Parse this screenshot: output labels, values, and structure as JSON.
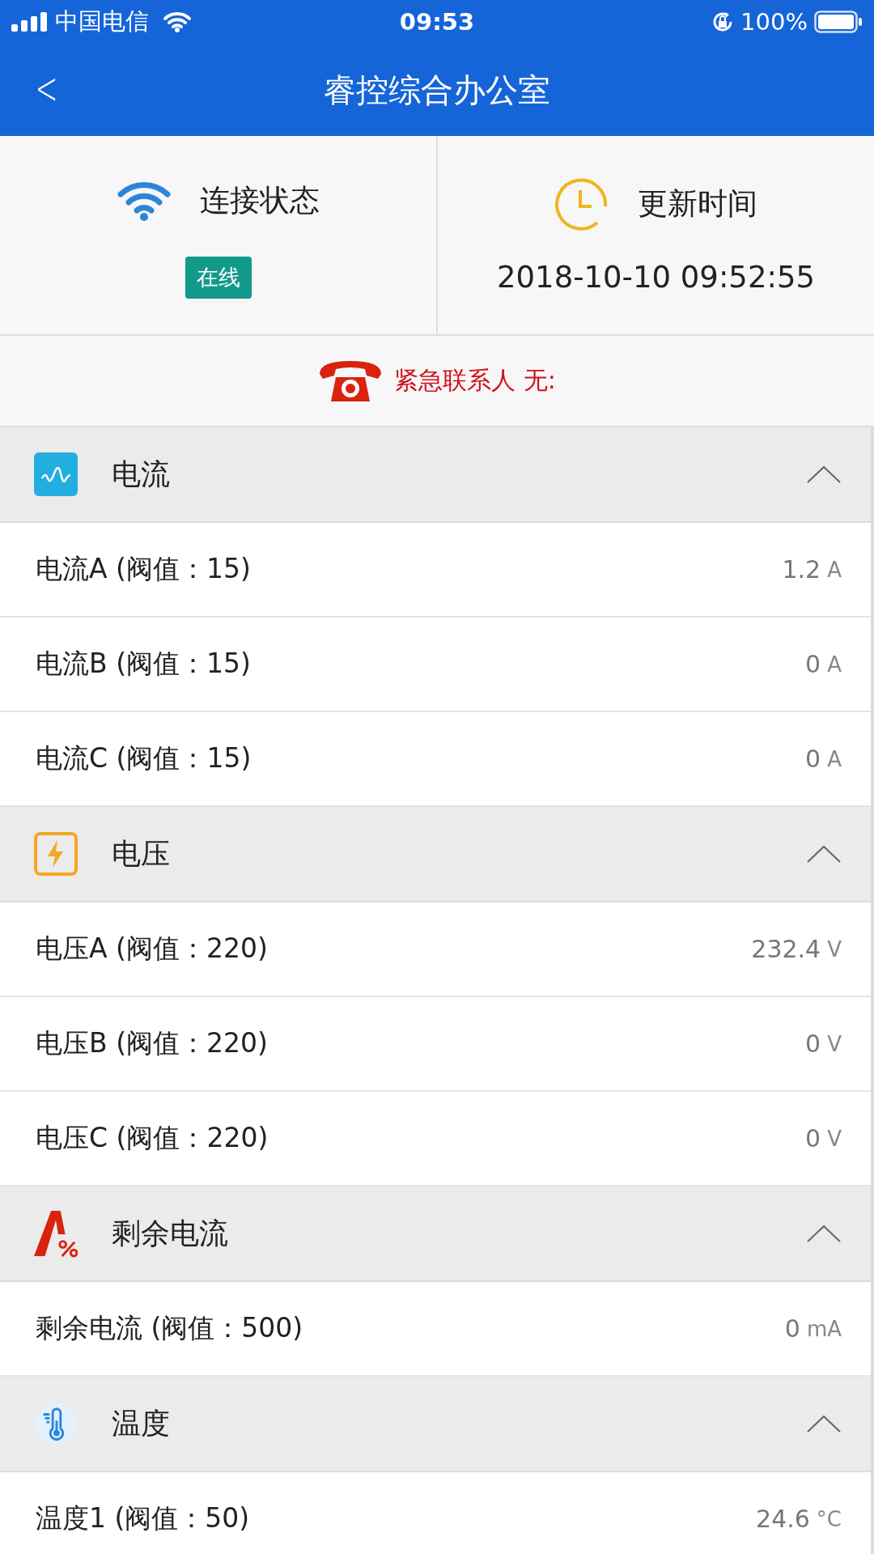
{
  "status_bar": {
    "carrier": "中国电信",
    "time": "09:53",
    "battery": "100%"
  },
  "nav": {
    "back": "<",
    "title": "睿控综合办公室"
  },
  "status_cards": [
    {
      "kind": "wifi",
      "label": "连接状态",
      "badge": "在线"
    },
    {
      "kind": "clock",
      "label": "更新时间",
      "value": "2018-10-10 09:52:55"
    }
  ],
  "emergency": {
    "text": "紧急联系人 无:"
  },
  "sections": [
    {
      "kind": "wave",
      "title": "电流",
      "expanded": true,
      "rows": [
        {
          "label": "电流A (阀值：15)",
          "value": "1.2",
          "unit": "A"
        },
        {
          "label": "电流B (阀值：15)",
          "value": "0",
          "unit": "A"
        },
        {
          "label": "电流C (阀值：15)",
          "value": "0",
          "unit": "A"
        }
      ]
    },
    {
      "kind": "bolt",
      "title": "电压",
      "expanded": true,
      "rows": [
        {
          "label": "电压A (阀值：220)",
          "value": "232.4",
          "unit": "V"
        },
        {
          "label": "电压B (阀值：220)",
          "value": "0",
          "unit": "V"
        },
        {
          "label": "电压C (阀值：220)",
          "value": "0",
          "unit": "V"
        }
      ]
    },
    {
      "kind": "residual",
      "title": "剩余电流",
      "expanded": true,
      "rows": [
        {
          "label": "剩余电流 (阀值：500)",
          "value": "0",
          "unit": "mA"
        }
      ]
    },
    {
      "kind": "thermo",
      "title": "温度",
      "expanded": true,
      "rows": [
        {
          "label": "温度1 (阀值：50)",
          "value": "24.6",
          "unit": "°C"
        }
      ]
    }
  ]
}
